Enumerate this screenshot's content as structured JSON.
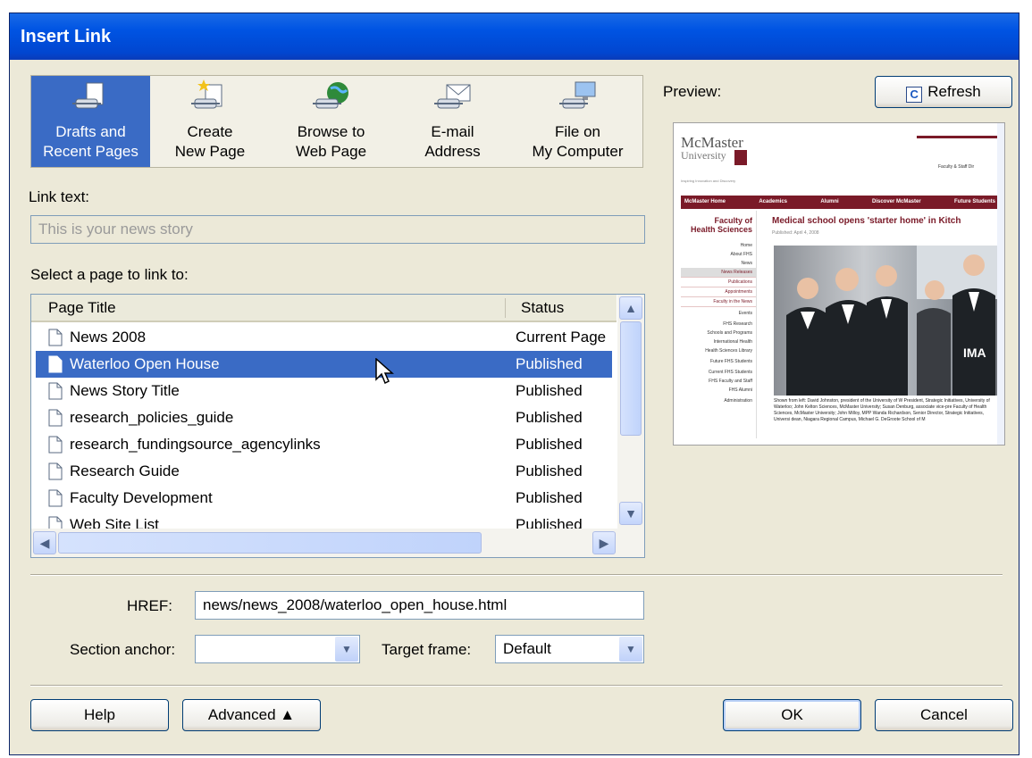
{
  "dialog": {
    "title": "Insert Link"
  },
  "sources": [
    {
      "label": "Drafts and\nRecent Pages",
      "icon": "drafts-pages-icon",
      "selected": true
    },
    {
      "label": "Create\nNew Page",
      "icon": "create-page-icon",
      "selected": false
    },
    {
      "label": "Browse to\nWeb Page",
      "icon": "browse-web-icon",
      "selected": false
    },
    {
      "label": "E-mail\nAddress",
      "icon": "email-icon",
      "selected": false
    },
    {
      "label": "File on\nMy Computer",
      "icon": "file-computer-icon",
      "selected": false
    }
  ],
  "link_text": {
    "label": "Link text:",
    "value": "This is your news story"
  },
  "page_list": {
    "label": "Select a page to link to:",
    "columns": [
      "Page Title",
      "Status"
    ],
    "rows": [
      {
        "title": "News 2008",
        "status": "Current Page",
        "selected": false
      },
      {
        "title": "Waterloo Open House",
        "status": "Published",
        "selected": true
      },
      {
        "title": "News Story Title",
        "status": "Published",
        "selected": false
      },
      {
        "title": "research_policies_guide",
        "status": "Published",
        "selected": false
      },
      {
        "title": "research_fundingsource_agencylinks",
        "status": "Published",
        "selected": false
      },
      {
        "title": "Research Guide",
        "status": "Published",
        "selected": false
      },
      {
        "title": "Faculty Development",
        "status": "Published",
        "selected": false
      },
      {
        "title": "Web Site List",
        "status": "Published",
        "selected": false
      }
    ]
  },
  "preview": {
    "label": "Preview:",
    "refresh_label": "Refresh",
    "logo_line1": "McMaster",
    "logo_line2": "University",
    "tagline": "Inspiring Innovation and Discovery",
    "topright": "Faculty & Staff Dir",
    "nav": [
      "McMaster Home",
      "Academics",
      "Alumni",
      "Discover McMaster",
      "Future Students"
    ],
    "faculty": "Faculty of\nHealth Sciences",
    "sidenav": [
      "Home",
      "About FHS",
      "News",
      "News Releases",
      "Publications",
      "Appointments",
      "Faculty in the News",
      "Events",
      "FHS Research",
      "Schools and Programs",
      "International Health",
      "Health Sciences Library",
      "Future FHS Students",
      "Current FHS Students",
      "FHS Faculty and Staff",
      "FHS Alumni",
      "Administration"
    ],
    "headline": "Medical school opens 'starter home' in Kitch",
    "published": "Published: April 4, 2008",
    "photo_sign": "IMA",
    "caption": "Shown from left: David Johnston, president of the University of W President, Strategic Initiatives, University of Waterloo; John Kelton Sciences, McMaster University; Susan Denburg, associate vice-pre Faculty of Health Sciences, McMaster University; John Milloy, MPP Wanda Richardson, Senior Director, Strategic Initiatives, Universi dean, Niagara Regional Campus, Michael G. DeGroote School of M"
  },
  "href": {
    "label": "HREF:",
    "value": "news/news_2008/waterloo_open_house.html"
  },
  "section_anchor": {
    "label": "Section anchor:",
    "value": ""
  },
  "target_frame": {
    "label": "Target frame:",
    "value": "Default"
  },
  "buttons": {
    "help": "Help",
    "advanced": "Advanced ▲",
    "ok": "OK",
    "cancel": "Cancel"
  },
  "top_strip_text": "..."
}
